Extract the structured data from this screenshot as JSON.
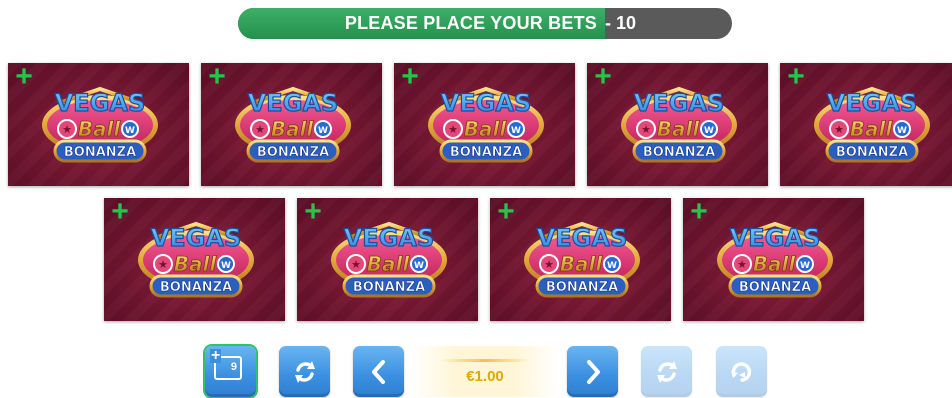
{
  "banner": {
    "label": "PLEASE PLACE YOUR BETS",
    "separator_count": "- 10",
    "countdown_remaining": 10
  },
  "cards": [
    {
      "logo_line1": "VEGAS",
      "logo_line2": "Ball",
      "logo_line3": "BONANZA",
      "add_icon": "plus-icon"
    },
    {
      "logo_line1": "VEGAS",
      "logo_line2": "Ball",
      "logo_line3": "BONANZA",
      "add_icon": "plus-icon"
    },
    {
      "logo_line1": "VEGAS",
      "logo_line2": "Ball",
      "logo_line3": "BONANZA",
      "add_icon": "plus-icon"
    },
    {
      "logo_line1": "VEGAS",
      "logo_line2": "Ball",
      "logo_line3": "BONANZA",
      "add_icon": "plus-icon"
    },
    {
      "logo_line1": "VEGAS",
      "logo_line2": "Ball",
      "logo_line3": "BONANZA",
      "add_icon": "plus-icon"
    },
    {
      "logo_line1": "VEGAS",
      "logo_line2": "Ball",
      "logo_line3": "BONANZA",
      "add_icon": "plus-icon"
    },
    {
      "logo_line1": "VEGAS",
      "logo_line2": "Ball",
      "logo_line3": "BONANZA",
      "add_icon": "plus-icon"
    },
    {
      "logo_line1": "VEGAS",
      "logo_line2": "Ball",
      "logo_line3": "BONANZA",
      "add_icon": "plus-icon"
    },
    {
      "logo_line1": "VEGAS",
      "logo_line2": "Ball",
      "logo_line3": "BONANZA",
      "add_icon": "plus-icon"
    }
  ],
  "controls": {
    "add_nine_cards": {
      "icon": "add-cards-icon",
      "count": "9"
    },
    "refresh": {
      "icon": "refresh-icon"
    },
    "stake_prev": {
      "icon": "chevron-left-icon"
    },
    "stake_value": "€1.00",
    "stake_next": {
      "icon": "chevron-right-icon"
    },
    "rebet": {
      "icon": "rebet-icon"
    },
    "auto": {
      "icon": "auto-play-icon"
    }
  },
  "colors": {
    "banner_green": "#2ea35a",
    "banner_dark": "#5a5a5a",
    "card_bg": "#7a1834",
    "plus_green": "#22c64a",
    "button_blue": "#3a8fe0",
    "stake_gold": "#e0a800"
  }
}
